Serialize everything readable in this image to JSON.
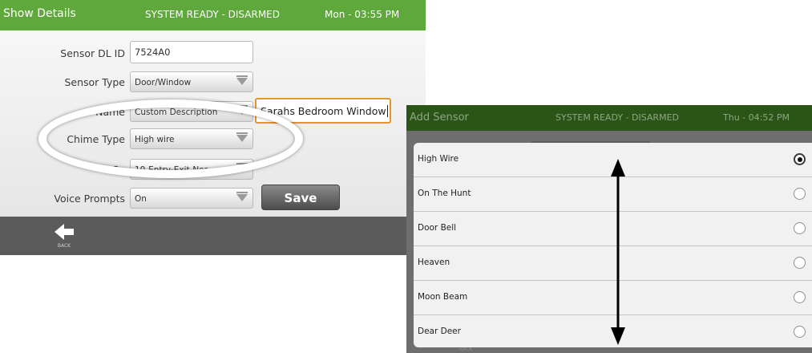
{
  "left_screen": {
    "header": {
      "title": "Show Details",
      "status": "SYSTEM READY - DISARMED",
      "datetime": "Mon - 03:55 PM"
    },
    "fields": {
      "sensor_dl_id": {
        "label": "Sensor DL ID",
        "value": "7524A0"
      },
      "sensor_type": {
        "label": "Sensor Type",
        "value": "Door/Window"
      },
      "sensor_name": {
        "label": "Sensor Name",
        "visible_label": "Name",
        "value": "Custom Description"
      },
      "custom_description": {
        "value": "Sarahs Bedroom Window"
      },
      "chime_type": {
        "label": "Chime Type",
        "value": "High wire"
      },
      "sensor_group": {
        "visible_label": "Se",
        "value": "10-Entry-Exit-Nor..."
      },
      "voice_prompts": {
        "label": "Voice Prompts",
        "value": "On"
      }
    },
    "save_label": "Save",
    "back_label": "BACK"
  },
  "right_screen": {
    "header": {
      "title": "Add Sensor",
      "status": "SYSTEM READY - DISARMED",
      "datetime": "Thu - 04:52 PM"
    },
    "back_label": "BACK",
    "chime_options": [
      {
        "label": "High Wire",
        "selected": true
      },
      {
        "label": "On The Hunt",
        "selected": false
      },
      {
        "label": "Door Bell",
        "selected": false
      },
      {
        "label": "Heaven",
        "selected": false
      },
      {
        "label": "Moon Beam",
        "selected": false
      },
      {
        "label": "Dear Deer",
        "selected": false
      }
    ]
  },
  "colors": {
    "header_green": "#5fa83c",
    "dimmed_header_green": "#2b5417",
    "focus_orange": "#e3962e",
    "footer_gray": "#5b5b5b"
  },
  "icons": {
    "back": "back-arrow-icon",
    "dropdown": "dropdown-arrow-icon",
    "scroll": "double-headed-arrow-icon"
  }
}
